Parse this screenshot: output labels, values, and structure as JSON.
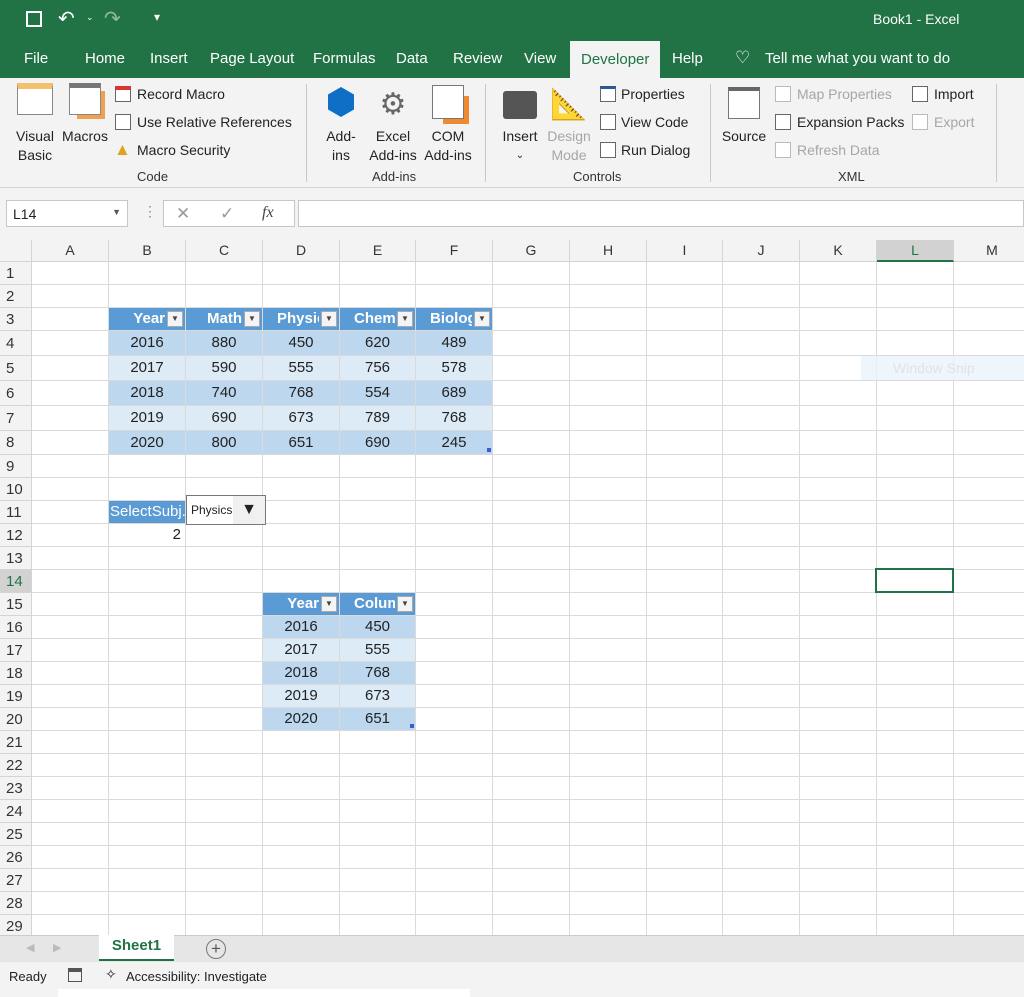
{
  "title": "Book1  -  Excel",
  "qat": {
    "save": "save-icon",
    "undo": "undo-icon",
    "redo": "redo-icon"
  },
  "tabs": [
    "File",
    "Home",
    "Insert",
    "Page Layout",
    "Formulas",
    "Data",
    "Review",
    "View",
    "Developer",
    "Help"
  ],
  "active_tab": "Developer",
  "tell_me": "Tell me what you want to do",
  "ribbon": {
    "code": {
      "label": "Code",
      "visual_basic": [
        "Visual",
        "Basic"
      ],
      "macros": "Macros",
      "record_macro": "Record Macro",
      "relative": "Use Relative References",
      "security": "Macro Security"
    },
    "addins": {
      "label": "Add-ins",
      "addins": [
        "Add-",
        "ins"
      ],
      "excel": [
        "Excel",
        "Add-ins"
      ],
      "com": [
        "COM",
        "Add-ins"
      ]
    },
    "controls": {
      "label": "Controls",
      "insert": "Insert",
      "design": [
        "Design",
        "Mode"
      ],
      "properties": "Properties",
      "view_code": "View Code",
      "run_dialog": "Run Dialog"
    },
    "xml": {
      "label": "XML",
      "source": "Source",
      "map_properties": "Map Properties",
      "expansion": "Expansion Packs",
      "refresh": "Refresh Data",
      "import": "Import",
      "export": "Export"
    }
  },
  "name_box": "L14",
  "formula_icon": "fx",
  "formula": "",
  "columns": [
    "A",
    "B",
    "C",
    "D",
    "E",
    "F",
    "G",
    "H",
    "I",
    "J",
    "K",
    "L",
    "M"
  ],
  "selected_cell": {
    "col": "L",
    "row": 14
  },
  "table1": {
    "headers": [
      "Year",
      "Math",
      "Physic",
      "Chemis",
      "Biolog"
    ],
    "rows": [
      [
        "2016",
        "880",
        "450",
        "620",
        "489"
      ],
      [
        "2017",
        "590",
        "555",
        "756",
        "578"
      ],
      [
        "2018",
        "740",
        "768",
        "554",
        "689"
      ],
      [
        "2019",
        "690",
        "673",
        "789",
        "768"
      ],
      [
        "2020",
        "800",
        "651",
        "690",
        "245"
      ]
    ]
  },
  "select_label": "SelectSubj.",
  "select_value": "2",
  "combo_value": "Physics",
  "table2": {
    "headers": [
      "Year",
      "Colum"
    ],
    "rows": [
      [
        "2016",
        "450"
      ],
      [
        "2017",
        "555"
      ],
      [
        "2018",
        "768"
      ],
      [
        "2019",
        "673"
      ],
      [
        "2020",
        "651"
      ]
    ]
  },
  "overlay": "Window Snip",
  "sheet_tab": "Sheet1",
  "status": {
    "ready": "Ready",
    "accessibility": "Accessibility: Investigate"
  },
  "colors": {
    "brand": "#217346",
    "table_header": "#5b9bd5",
    "band1": "#bdd7ee",
    "band2": "#ddebf7"
  }
}
